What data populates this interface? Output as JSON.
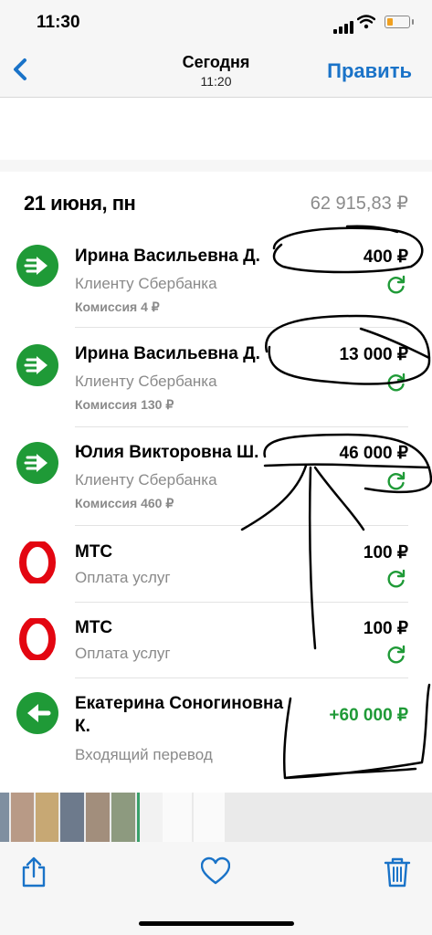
{
  "status_bar": {
    "time": "11:30"
  },
  "nav": {
    "title": "Сегодня",
    "subtitle": "11:20",
    "edit": "Править"
  },
  "day": {
    "date": "21 июня, пн",
    "balance": "62 915,83 ₽"
  },
  "transactions": [
    {
      "icon": "transfer-out-icon",
      "name": "Ирина Васильевна Д.",
      "amount": "400 ₽",
      "type": "Клиенту Сбербанка",
      "fee": "Комиссия 4 ₽"
    },
    {
      "icon": "transfer-out-icon",
      "name": "Ирина Васильевна Д.",
      "amount": "13 000 ₽",
      "type": "Клиенту Сбербанка",
      "fee": "Комиссия 130 ₽"
    },
    {
      "icon": "transfer-out-icon",
      "name": "Юлия Викторовна Ш.",
      "amount": "46 000 ₽",
      "type": "Клиенту Сбербанка",
      "fee": "Комиссия 460 ₽"
    },
    {
      "icon": "mts-logo-icon",
      "name": "МТС",
      "amount": "100 ₽",
      "type": "Оплата услуг"
    },
    {
      "icon": "mts-logo-icon",
      "name": "МТС",
      "amount": "100 ₽",
      "type": "Оплата услуг"
    },
    {
      "icon": "transfer-in-icon",
      "name_line1": "Екатерина Соногиновна",
      "name_line2": "К.",
      "amount": "+60 000 ₽",
      "type": "Входящий перевод"
    }
  ],
  "colors": {
    "accent_green": "#1f9a37",
    "link_blue": "#1a73c8",
    "mts_red": "#e30611"
  }
}
